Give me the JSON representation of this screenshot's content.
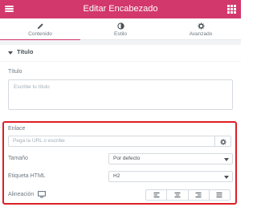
{
  "header": {
    "title": "Editar Encabezado",
    "left_icon": "hamburger-menu-icon",
    "right_icon": "apps-grid-icon"
  },
  "tabs": [
    {
      "label": "Contenido",
      "icon": "pencil-icon",
      "active": true
    },
    {
      "label": "Estilo",
      "icon": "contrast-icon",
      "active": false
    },
    {
      "label": "Avanzado",
      "icon": "gear-icon",
      "active": false
    }
  ],
  "section": {
    "title": "Título"
  },
  "fields": {
    "title_label": "Título",
    "title_placeholder": "Escribe tu título",
    "link_label": "Enlace",
    "link_placeholder": "Pega la URL o escribe",
    "size_label": "Tamaño",
    "size_value": "Por defecto",
    "html_tag_label": "Etiqueta HTML",
    "html_tag_value": "H2",
    "alignment_label": "Alineación",
    "alignment_options": [
      "left",
      "center",
      "right",
      "justify"
    ]
  },
  "colors": {
    "brand": "#d2386b",
    "highlight": "#dd1f26"
  }
}
